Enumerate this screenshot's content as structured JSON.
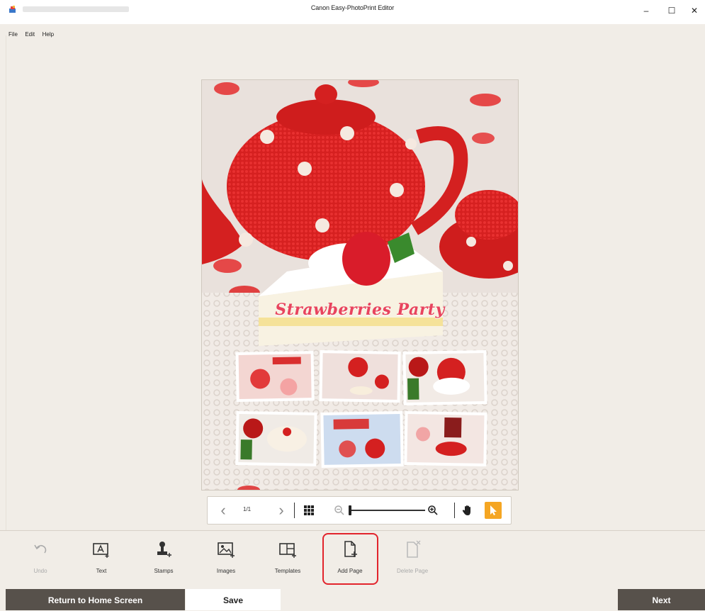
{
  "window": {
    "title": "Canon Easy-PhotoPrint Editor",
    "minimize_glyph": "–",
    "maximize_glyph": "☐",
    "close_glyph": "✕"
  },
  "menu": [
    "File",
    "Edit",
    "Help"
  ],
  "canvas": {
    "banner_text": "Strawberries Party"
  },
  "navigation": {
    "prev_glyph": "‹",
    "next_glyph": "›",
    "page_indicator": "1/1",
    "zoom_level_fraction": 0.0
  },
  "toolbar": {
    "items": [
      {
        "label": "Undo",
        "icon": "undo-icon",
        "enabled": false
      },
      {
        "label": "Text",
        "icon": "text-icon",
        "enabled": true
      },
      {
        "label": "Stamps",
        "icon": "stamp-icon",
        "enabled": true
      },
      {
        "label": "Images",
        "icon": "image-icon",
        "enabled": true
      },
      {
        "label": "Templates",
        "icon": "template-icon",
        "enabled": true
      },
      {
        "label": "Add Page",
        "icon": "add-page-icon",
        "enabled": true
      },
      {
        "label": "Delete Page",
        "icon": "delete-page-icon",
        "enabled": false
      }
    ],
    "highlight_color": "#e2242c"
  },
  "footer": {
    "return_label": "Return to Home Screen",
    "save_label": "Save",
    "next_label": "Next"
  },
  "colors": {
    "accent_orange": "#f5a623",
    "dark_button": "#57514b",
    "background": "#f1ede7"
  }
}
